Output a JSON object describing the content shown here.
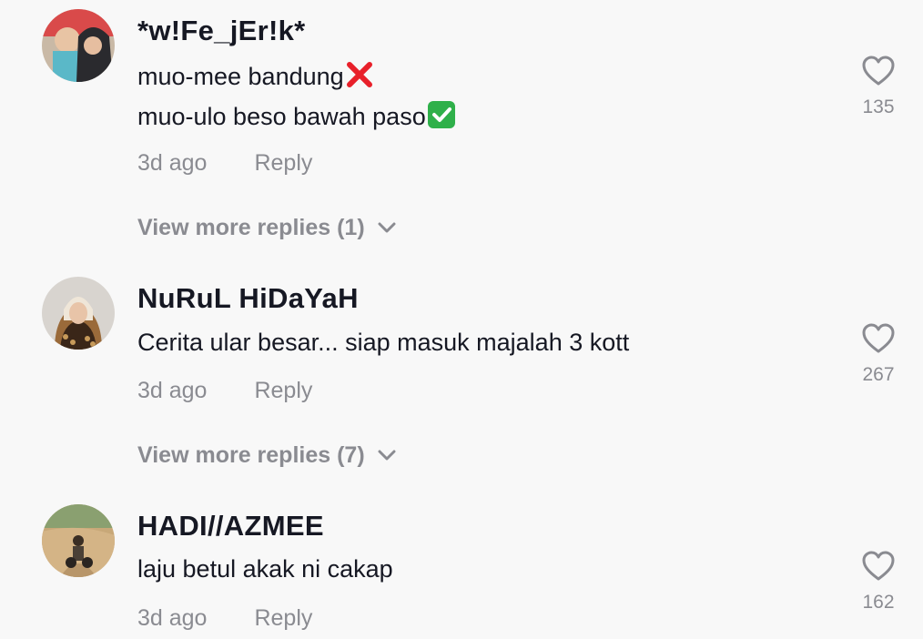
{
  "comments": [
    {
      "username": "*w!Fe_jEr!k*",
      "lines": [
        "muo-mee bandung",
        "muo-ulo beso bawah paso"
      ],
      "line_marks": [
        "cross-mark-icon",
        "check-mark-icon"
      ],
      "time": "3d ago",
      "reply_label": "Reply",
      "view_more": "View more replies (1)",
      "likes": "135"
    },
    {
      "username": "NuRuL HiDaYaH",
      "lines": [
        "Cerita ular besar... siap masuk majalah 3 kott"
      ],
      "time": "3d ago",
      "reply_label": "Reply",
      "view_more": "View more replies (7)",
      "likes": "267"
    },
    {
      "username": "HADI//AZMEE",
      "lines": [
        "laju betul akak ni cakap"
      ],
      "time": "3d ago",
      "reply_label": "Reply",
      "likes": "162"
    }
  ],
  "colors": {
    "background": "#f8f8f8",
    "text": "#161823",
    "muted": "#8a8b91",
    "cross": "#e8202a",
    "check": "#2fb04a"
  }
}
